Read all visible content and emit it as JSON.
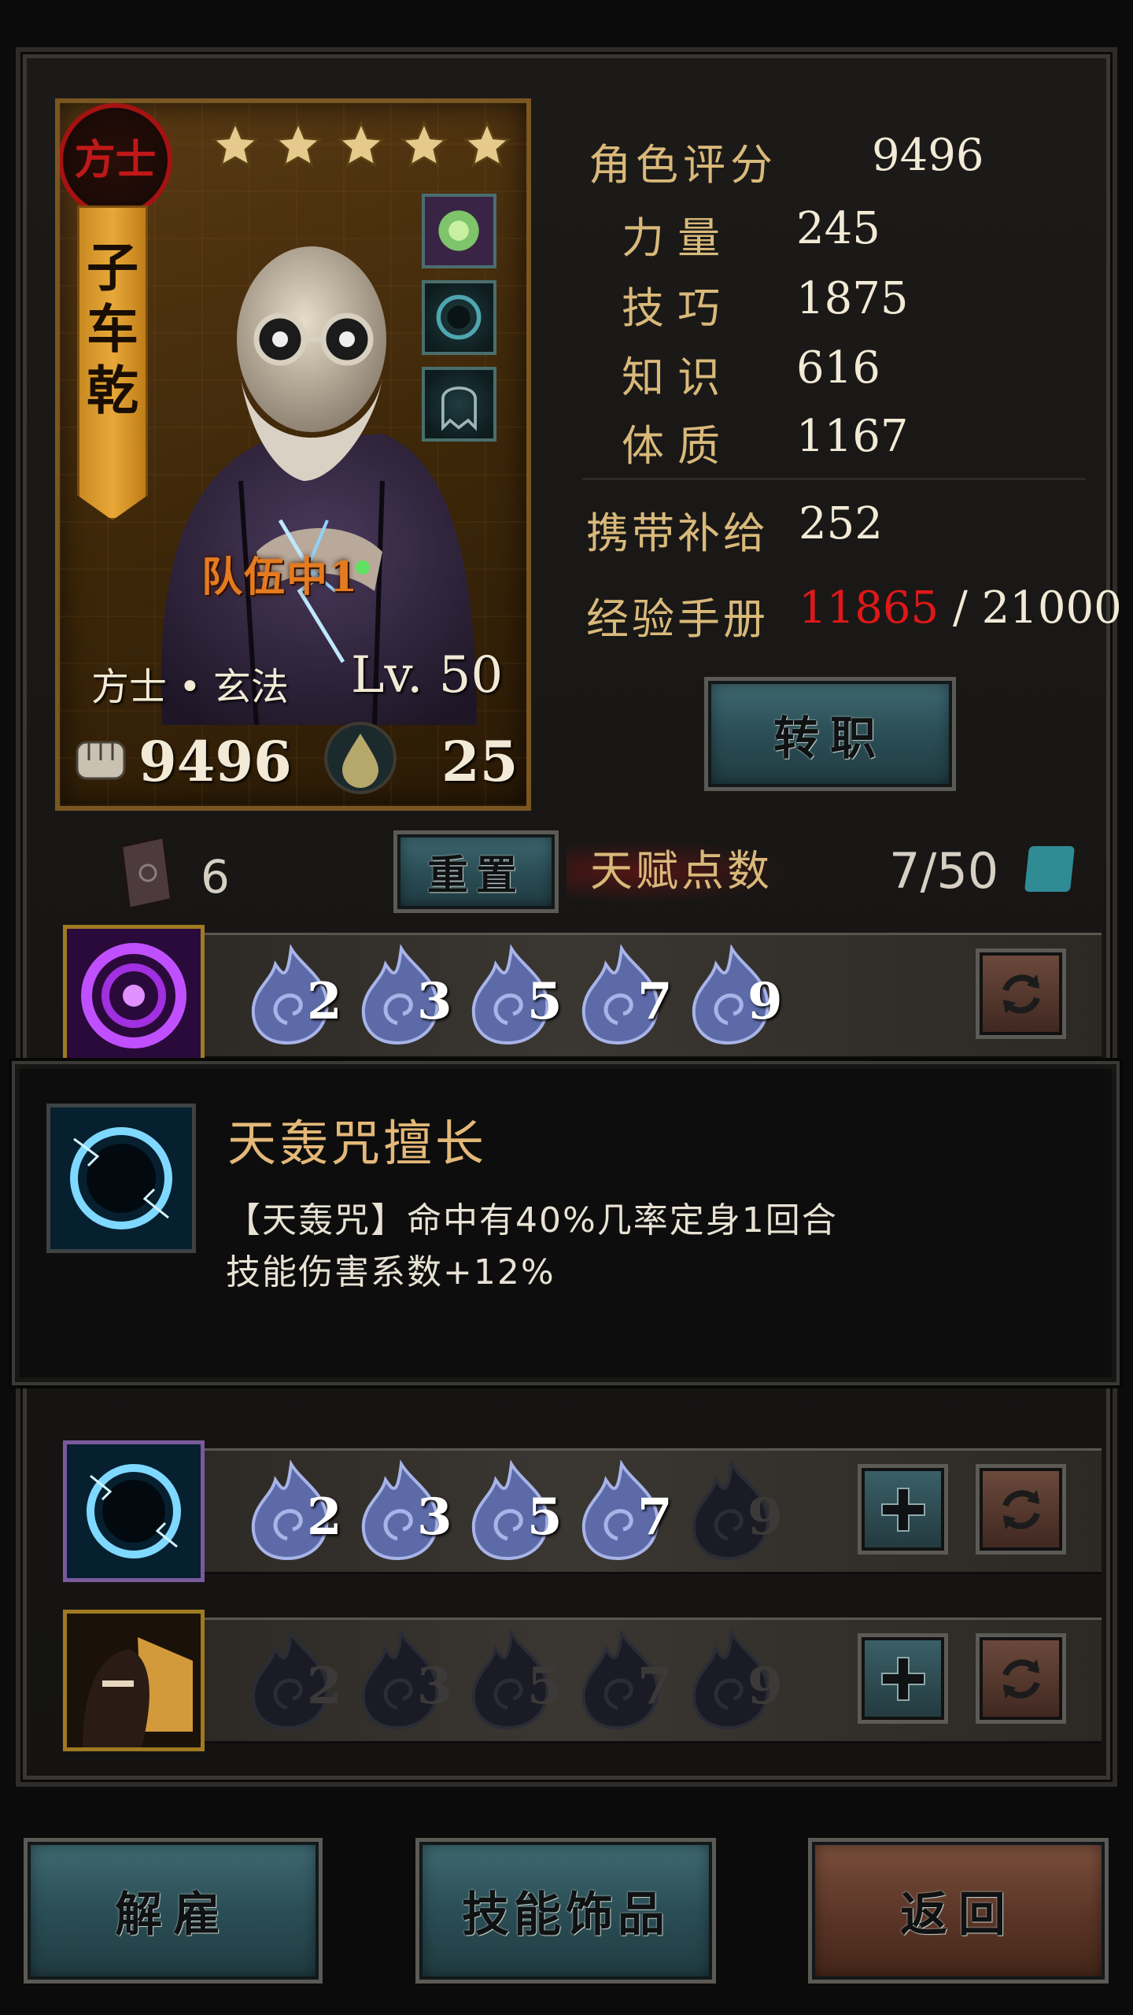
{
  "character": {
    "class_seal": "方士",
    "name_chars": [
      "子",
      "车",
      "乾"
    ],
    "stars": 5,
    "team_tag": "队伍中1",
    "subclass": "方士 • 玄法",
    "level": "Lv. 50",
    "power": "9496",
    "supply_icon_value": "25",
    "equipment": [
      "green-gem-icon",
      "dark-orb-icon",
      "ghost-icon"
    ]
  },
  "stats": {
    "score_label": "角色评分",
    "score_value": "9496",
    "rows": [
      {
        "label": "力  量",
        "value": "245"
      },
      {
        "label": "技  巧",
        "value": "1875"
      },
      {
        "label": "知  识",
        "value": "616"
      },
      {
        "label": "体  质",
        "value": "1167"
      }
    ],
    "supply_label": "携带补给",
    "supply_value": "252",
    "exp_label": "经验手册",
    "exp_current": "11865",
    "exp_sep": " / ",
    "exp_max": "21000"
  },
  "buttons": {
    "transfer": "转职",
    "reset": "重置",
    "dismiss": "解雇",
    "skill_accessory": "技能饰品",
    "back": "返回"
  },
  "talent": {
    "book_count": "6",
    "label": "天赋点数",
    "points": "7/50"
  },
  "skills": [
    {
      "icon": "purple-vortex-icon",
      "levels": [
        "2",
        "3",
        "5",
        "7",
        "9"
      ],
      "unlocked": 5,
      "has_add": false
    },
    {
      "icon": "lightning-ring-icon",
      "levels": [
        "2",
        "3",
        "5",
        "7",
        "9"
      ],
      "unlocked": 4,
      "has_add": true
    },
    {
      "icon": "dark-figure-icon",
      "levels": [
        "2",
        "3",
        "5",
        "7",
        "9"
      ],
      "unlocked": 0,
      "has_add": true
    }
  ],
  "tooltip": {
    "title": "天轰咒擅长",
    "line1": "【天轰咒】命中有40%几率定身1回合",
    "line2": "技能伤害系数+12%"
  },
  "colors": {
    "accent_gold": "#d9b97a",
    "exp_red": "#e01818",
    "flame_blue": "#5c6aa8"
  }
}
